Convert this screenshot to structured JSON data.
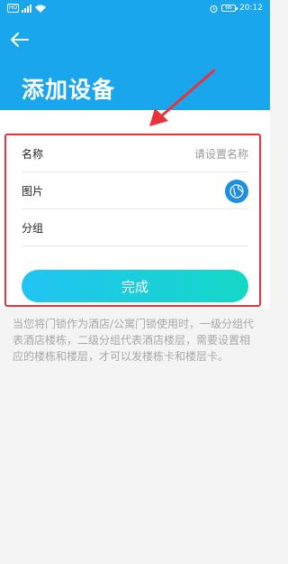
{
  "status_bar": {
    "sim_label": "HD",
    "battery": "66",
    "time": "20:12"
  },
  "header": {
    "title": "添加设备"
  },
  "form": {
    "name_label": "名称",
    "name_placeholder": "请设置名称",
    "image_label": "图片",
    "group_label": "分组",
    "submit_label": "完成"
  },
  "note": "当您将门锁作为酒店/公寓门锁使用时，一级分组代表酒店楼栋，二级分组代表酒店楼层，需要设置相应的楼栋和楼层，才可以发楼栋卡和楼层卡。",
  "colors": {
    "header_bg": "#1aa6ec",
    "button_gradient_start": "#21c4f2",
    "button_gradient_end": "#14d8c6",
    "annotation": "#e8333a"
  },
  "icons": {
    "back": "arrow-left-icon",
    "image_picker": "globe-icon",
    "wifi": "wifi-icon",
    "signal": "signal-icon",
    "alarm": "alarm-icon"
  }
}
